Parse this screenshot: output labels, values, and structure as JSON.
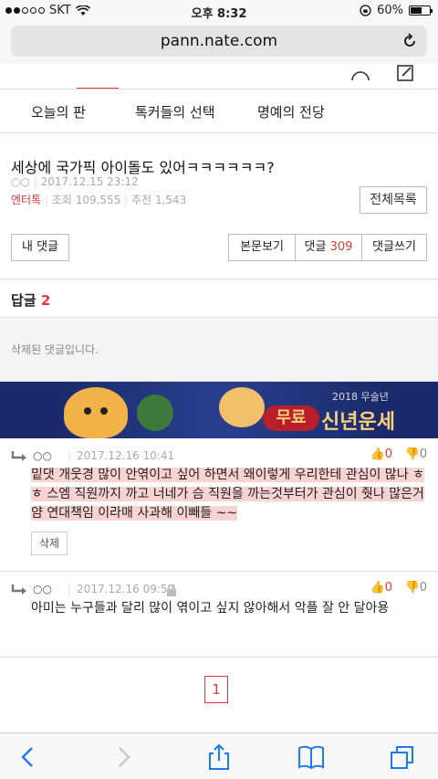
{
  "status": {
    "carrier": "SKT",
    "time": "오후 8:32",
    "battery_percent": 60,
    "battery_label": "60%"
  },
  "browser": {
    "url": "pann.nate.com"
  },
  "subnav": {
    "items": [
      "오늘의 판",
      "톡커들의 선택",
      "명예의 전당"
    ],
    "all_label": "전체목록"
  },
  "post": {
    "title": "세상에 국가픽 아이돌도 있어ㅋㅋㅋㅋㅋㅋ?",
    "author": "○○",
    "date": "2017.12.15 23:12",
    "category": "엔터톡",
    "views_label": "조회 109,555",
    "recommend_label": "추천 1,543"
  },
  "buttons": {
    "my_comments": "내 댓글",
    "view_post": "본문보기",
    "comments_label": "댓글",
    "comments_count": "309",
    "write_comment": "댓글쓰기"
  },
  "reply_section": {
    "label": "답글",
    "count": "2",
    "deleted_text": "삭제된 댓글입니다."
  },
  "banner": {
    "year_text": "2018 무술년",
    "free_text": "무료",
    "title_text": "신년운세"
  },
  "comments": [
    {
      "user": "○○",
      "date": "2017.12.16 10:41",
      "likes": "0",
      "dislikes": "0",
      "body": "밑댓 개웃경 많이 안엮이고 싶어 하면서 왜이렇게 우리한테 관심이 많나 ㅎㅎ 스엠 직원까지 까고 너네가 슴 직원을 까는것부터가 관심이 줫나 많은거얌 연대책임 이라매 사과해 이빼들 ~~",
      "delete_label": "삭제"
    },
    {
      "user": "○○",
      "date": "2017.12.16 09:52",
      "likes": "0",
      "dislikes": "0",
      "body": "아미는 누구들과 달리 많이 엮이고 싶지 않아해서 악플 잘 안 달아용"
    }
  ],
  "pagination": {
    "current": "1"
  },
  "colors": {
    "accent": "#e03a3a",
    "highlight": "#f8d3d1",
    "ios_blue": "#1a7cf5"
  }
}
